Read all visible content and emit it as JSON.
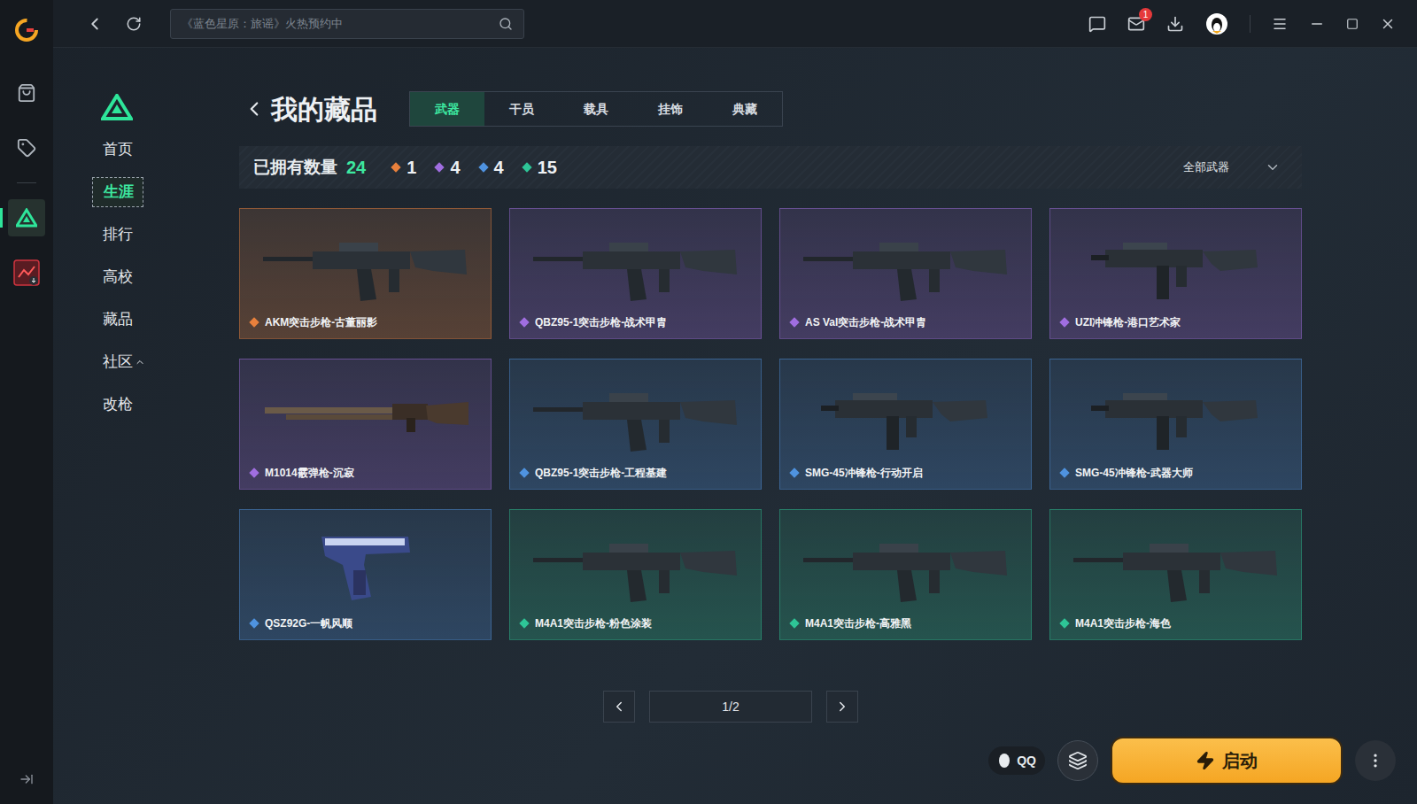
{
  "search": {
    "placeholder": "《蓝色星原：旅谣》火热预约中"
  },
  "top_bar": {
    "mail_badge": "1"
  },
  "rail_items": [
    {
      "kind": "bag",
      "selected": false
    },
    {
      "kind": "tag",
      "selected": false
    },
    {
      "kind": "delta",
      "selected": true
    },
    {
      "kind": "game",
      "selected": false
    }
  ],
  "nav": {
    "items": [
      {
        "label": "首页",
        "selected": false
      },
      {
        "label": "生涯",
        "selected": true
      },
      {
        "label": "排行",
        "selected": false
      },
      {
        "label": "高校",
        "selected": false
      },
      {
        "label": "藏品",
        "selected": false
      },
      {
        "label": "社区",
        "selected": false,
        "expanded": true
      },
      {
        "label": "改枪",
        "selected": false
      }
    ]
  },
  "page": {
    "title": "我的藏品",
    "tabs": [
      {
        "label": "武器",
        "selected": true
      },
      {
        "label": "干员",
        "selected": false
      },
      {
        "label": "载具",
        "selected": false
      },
      {
        "label": "挂饰",
        "selected": false
      },
      {
        "label": "典藏",
        "selected": false
      }
    ]
  },
  "stats": {
    "label": "已拥有数量",
    "total": "24",
    "rarities": [
      {
        "count": "1",
        "color": "#e8803c"
      },
      {
        "count": "4",
        "color": "#a06ee0"
      },
      {
        "count": "4",
        "color": "#4f93e0"
      },
      {
        "count": "15",
        "color": "#2ec597"
      }
    ]
  },
  "filter": {
    "label": "全部武器"
  },
  "weapons": [
    {
      "name": "AKM突击步枪-古董丽影",
      "color": "#e8803c",
      "kind": "rifle"
    },
    {
      "name": "QBZ95-1突击步枪-战术甲胄",
      "color": "#a06ee0",
      "kind": "rifle"
    },
    {
      "name": "AS Val突击步枪-战术甲胄",
      "color": "#a06ee0",
      "kind": "rifle"
    },
    {
      "name": "UZI冲锋枪-港口艺术家",
      "color": "#a06ee0",
      "kind": "smg"
    },
    {
      "name": "M1014霰弹枪-沉寂",
      "color": "#a06ee0",
      "kind": "shotgun"
    },
    {
      "name": "QBZ95-1突击步枪-工程基建",
      "color": "#4f93e0",
      "kind": "rifle"
    },
    {
      "name": "SMG-45冲锋枪-行动开启",
      "color": "#4f93e0",
      "kind": "smg"
    },
    {
      "name": "SMG-45冲锋枪-武器大师",
      "color": "#4f93e0",
      "kind": "smg"
    },
    {
      "name": "QSZ92G-一帆风顺",
      "color": "#4f93e0",
      "kind": "pistol"
    },
    {
      "name": "M4A1突击步枪-粉色涂装",
      "color": "#2ec597",
      "kind": "rifle"
    },
    {
      "name": "M4A1突击步枪-高雅黑",
      "color": "#2ec597",
      "kind": "rifle"
    },
    {
      "name": "M4A1突击步枪-海色",
      "color": "#2ec597",
      "kind": "rifle"
    }
  ],
  "pagination": {
    "page": "1/2"
  },
  "bottom": {
    "qq": "QQ",
    "launch": "启动"
  }
}
